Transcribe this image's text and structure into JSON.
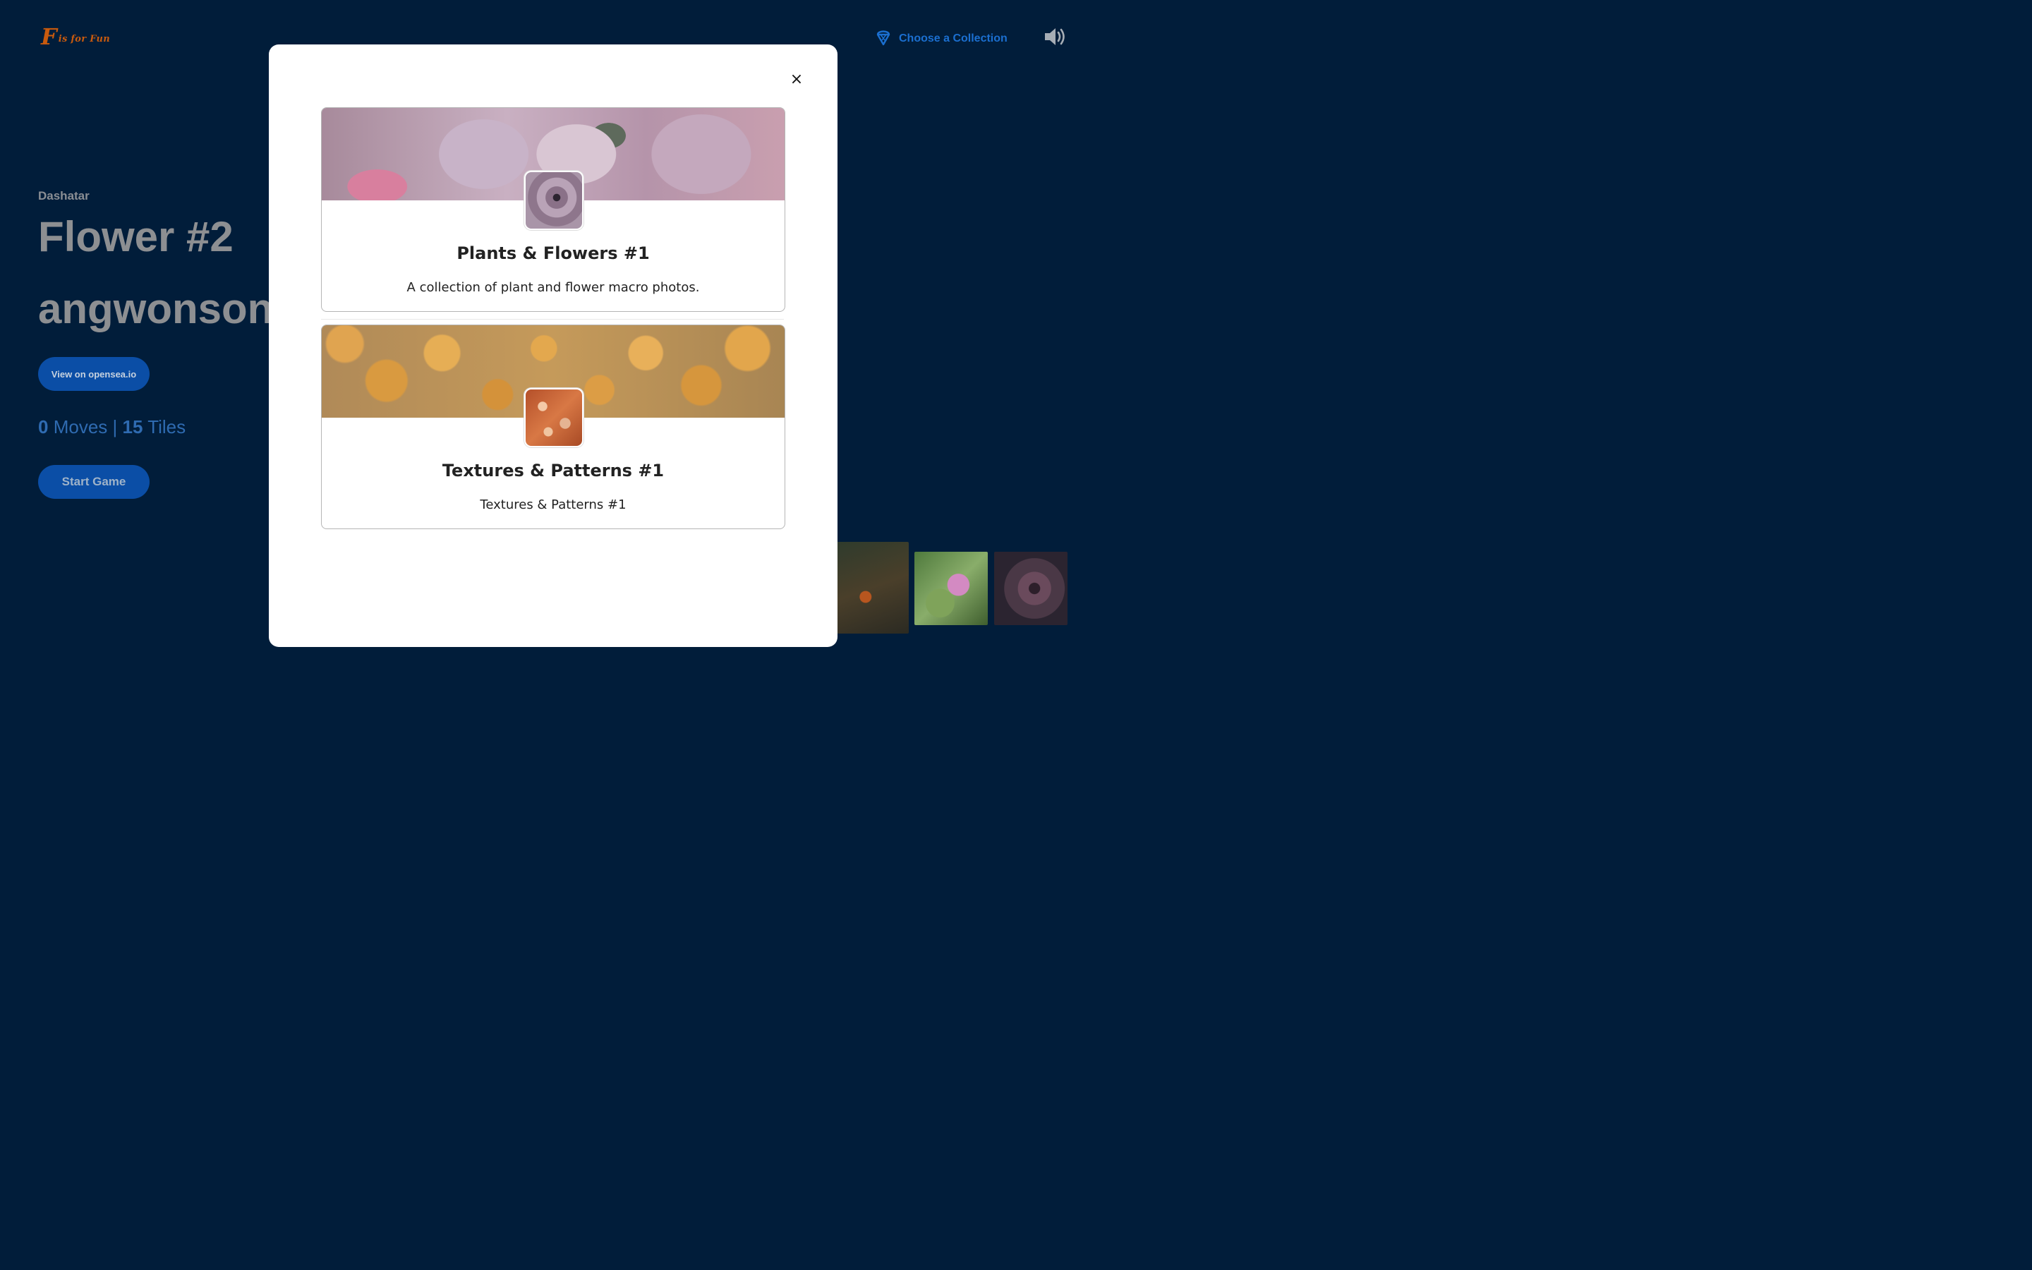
{
  "header": {
    "logo": {
      "big_letter": "F",
      "rest": "is for Fun"
    },
    "choose_collection_label": "Choose a Collection",
    "sound_icon": "speaker-on-icon",
    "accent_color": "#1b6fd0",
    "logo_color": "#c85a0e"
  },
  "artwork": {
    "artist": "Dashatar",
    "title_line1": "Flower #2",
    "title_line2": "angwonson",
    "opensea_button_label": "View on opensea.io",
    "stats": {
      "moves_count": "0",
      "moves_label": "Moves",
      "separator": "|",
      "tiles_count": "15",
      "tiles_label": "Tiles"
    },
    "start_button_label": "Start Game"
  },
  "modal": {
    "close_label": "×",
    "collections": [
      {
        "title": "Plants & Flowers #1",
        "description": "A collection of plant and flower macro photos."
      },
      {
        "title": "Textures & Patterns #1",
        "description": "Textures & Patterns #1"
      }
    ]
  },
  "colors": {
    "background": "#011d3a",
    "button_bg": "#0b4ea6"
  }
}
